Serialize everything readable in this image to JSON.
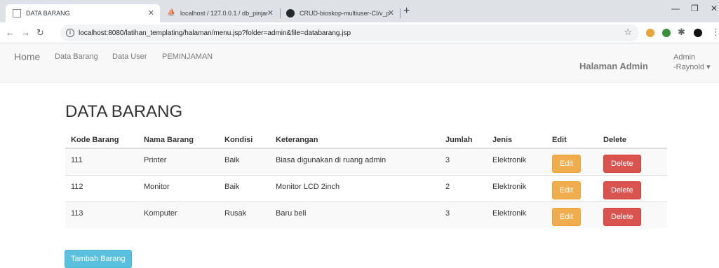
{
  "browser": {
    "tabs": [
      {
        "title": "DATA BARANG",
        "active": true
      },
      {
        "title": "localhost / 127.0.0.1 / db_pinjam",
        "active": false
      },
      {
        "title": "CRUD-bioskop-multiuser-CI/v_p",
        "active": false
      }
    ],
    "url": "localhost:8080/latihan_templating/halaman/menu.jsp?folder=admin&file=databarang.jsp",
    "colors": {
      "tabstrip": "#dee1e6",
      "omnibox": "#f1f3f4"
    }
  },
  "navbar": {
    "brand": "Home",
    "links": [
      "Data Barang",
      "Data User",
      "PEMINJAMAN"
    ],
    "admin_title": "Halaman Admin",
    "user_line1": "Admin",
    "user_line2": "-Raynold ▾"
  },
  "page": {
    "title": "DATA BARANG",
    "add_button": "Tambah Barang"
  },
  "table": {
    "headers": [
      "Kode Barang",
      "Nama Barang",
      "Kondisi",
      "Keterangan",
      "Jumlah",
      "Jenis",
      "Edit",
      "Delete"
    ],
    "rows": [
      {
        "kode": "111",
        "nama": "Printer",
        "kondisi": "Baik",
        "keterangan": "Biasa digunakan di ruang admin",
        "jumlah": "3",
        "jenis": "Elektronik"
      },
      {
        "kode": "112",
        "nama": "Monitor",
        "kondisi": "Baik",
        "keterangan": "Monitor LCD 2inch",
        "jumlah": "2",
        "jenis": "Elektronik"
      },
      {
        "kode": "113",
        "nama": "Komputer",
        "kondisi": "Rusak",
        "keterangan": "Baru beli",
        "jumlah": "3",
        "jenis": "Elektronik"
      }
    ],
    "edit_label": "Edit",
    "delete_label": "Delete"
  },
  "colors": {
    "edit": "#f0ad4e",
    "delete": "#d9534f",
    "add": "#5bc0de",
    "navbar_bg": "#f8f8f8"
  }
}
